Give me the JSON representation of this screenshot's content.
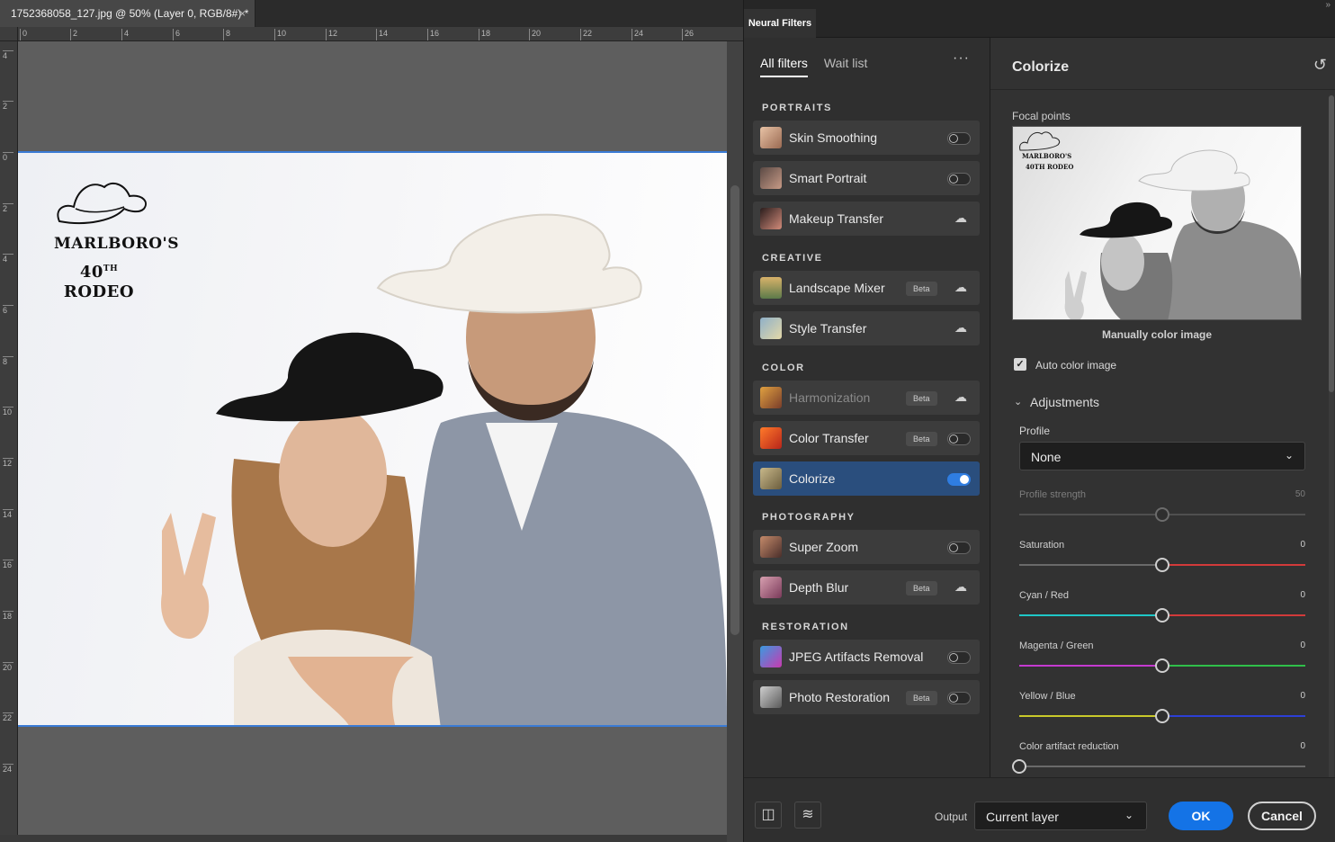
{
  "document": {
    "tab_title": "1752368058_127.jpg @ 50% (Layer 0, RGB/8#) *",
    "close_glyph": "×",
    "ruler_top": [
      "0",
      "2",
      "4",
      "6",
      "8",
      "10",
      "12",
      "14",
      "16",
      "18",
      "20",
      "22",
      "24",
      "26"
    ],
    "ruler_left": [
      "4",
      "2",
      "0",
      "2",
      "4",
      "6",
      "8",
      "10",
      "12",
      "14",
      "16",
      "18",
      "20",
      "22",
      "24"
    ],
    "logo_line1": "MARLBORO'S",
    "logo_line2_num": "40",
    "logo_line2_sup": "TH",
    "logo_line2_word": "RODEO"
  },
  "panel": {
    "title": "Neural Filters",
    "expand_glyph": "»",
    "tabs": [
      {
        "label": "All filters",
        "active": true
      },
      {
        "label": "Wait list",
        "active": false
      }
    ],
    "more_glyph": "···",
    "sections": {
      "portraits": "PORTRAITS",
      "creative": "CREATIVE",
      "color": "COLOR",
      "photography": "PHOTOGRAPHY",
      "restoration": "RESTORATION"
    },
    "filters": {
      "skin_smoothing": {
        "label": "Skin Smoothing",
        "state": "off"
      },
      "smart_portrait": {
        "label": "Smart Portrait",
        "state": "off"
      },
      "makeup_transfer": {
        "label": "Makeup Transfer",
        "state": "cloud"
      },
      "landscape_mixer": {
        "label": "Landscape Mixer",
        "badge": "Beta",
        "state": "cloud"
      },
      "style_transfer": {
        "label": "Style Transfer",
        "state": "cloud"
      },
      "harmonization": {
        "label": "Harmonization",
        "badge": "Beta",
        "state": "cloud"
      },
      "color_transfer": {
        "label": "Color Transfer",
        "badge": "Beta",
        "state": "off"
      },
      "colorize": {
        "label": "Colorize",
        "state": "on"
      },
      "super_zoom": {
        "label": "Super Zoom",
        "state": "off"
      },
      "depth_blur": {
        "label": "Depth Blur",
        "badge": "Beta",
        "state": "cloud"
      },
      "jpeg_artifacts_removal": {
        "label": "JPEG Artifacts Removal",
        "state": "off"
      },
      "photo_restoration": {
        "label": "Photo Restoration",
        "badge": "Beta",
        "state": "off"
      }
    },
    "cloud_glyph": "☁",
    "settings": {
      "title": "Colorize",
      "reset_glyph": "↺",
      "focal_points": "Focal points",
      "preview_logo_line1": "MARLBORO'S",
      "preview_logo_line2": "40TH RODEO",
      "manual_color": "Manually color image",
      "auto_color_checked": true,
      "check_glyph": "✓",
      "auto_color_label": "Auto color image",
      "adjustments_chevron": "⌄",
      "adjustments_label": "Adjustments",
      "profile_label": "Profile",
      "profile_value": "None",
      "select_chevron": "⌄",
      "sliders": {
        "profile_strength": {
          "label": "Profile strength",
          "value": "50",
          "level": 0.5,
          "disabled": true
        },
        "saturation": {
          "label": "Saturation",
          "value": "0",
          "level": 0.5
        },
        "cyan_red": {
          "label": "Cyan / Red",
          "value": "0",
          "level": 0.5,
          "left_color": "#1fc7c7",
          "right_color": "#d23a3a"
        },
        "magenta_green": {
          "label": "Magenta / Green",
          "value": "0",
          "level": 0.5,
          "left_color": "#c53ad0",
          "right_color": "#2fbf4a"
        },
        "yellow_blue": {
          "label": "Yellow / Blue",
          "value": "0",
          "level": 0.5,
          "left_color": "#c9c92a",
          "right_color": "#2c3fd6"
        },
        "color_artifact_reduction": {
          "label": "Color artifact reduction",
          "value": "0",
          "level": 0.0
        }
      }
    },
    "footer": {
      "compare_glyph": "◫",
      "layers_glyph": "≋",
      "output_label": "Output",
      "output_value": "Current layer",
      "ok_label": "OK",
      "cancel_label": "Cancel"
    },
    "colors": {
      "accent": "#1473e6",
      "selected_row": "#2a4e7d",
      "toggle_on": "#2f7de1",
      "saturation_right": "#d23a3a"
    }
  }
}
